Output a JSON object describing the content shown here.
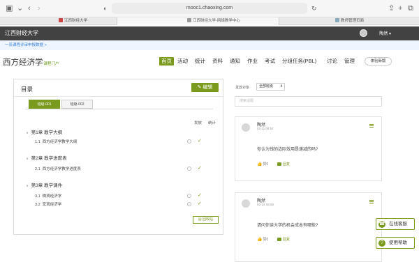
{
  "browser": {
    "url": "mooc1.chaoxing.com",
    "tabs": [
      {
        "label": "江西财经大学",
        "active": false
      },
      {
        "label": "江西财经大学-网络教学中心",
        "active": true
      },
      {
        "label": "教师管理页面",
        "active": false
      }
    ]
  },
  "topbar": {
    "school": "江西财经大学",
    "user": "陶然"
  },
  "notice": {
    "text": "一流课程评审申报数据  >"
  },
  "course": {
    "title": "西方经济学",
    "subtitle": "课程门户"
  },
  "nav": {
    "items": [
      "首页",
      "活动",
      "统计",
      "资料",
      "通知",
      "作业",
      "考试",
      "分组任务(PBL)",
      "讨论",
      "管理"
    ],
    "experience_btn": "体验新版"
  },
  "toc": {
    "title": "目录",
    "edit_label": "编辑",
    "class_tabs": [
      "班级-001",
      "班级-002"
    ],
    "col_publish": "发放",
    "col_stats": "统计",
    "chapters": [
      {
        "title": "第1章  教学大纲",
        "lessons": [
          {
            "num": "1.1",
            "title": "西方经济学教学大纲"
          }
        ]
      },
      {
        "title": "第2章  教学进度表",
        "lessons": [
          {
            "num": "2.1",
            "title": "西方经济学教学进度表"
          }
        ]
      },
      {
        "title": "第3章  教学课件",
        "lessons": [
          {
            "num": "3.1",
            "title": "微观经济学"
          },
          {
            "num": "3.2",
            "title": "宏观经济学"
          }
        ]
      }
    ],
    "recycle_label": "回收站"
  },
  "discussion": {
    "publish_label": "发放对象",
    "publish_select": "全部班级",
    "search_placeholder": "搜索话题",
    "posts": [
      {
        "author": "陶然",
        "date": "03-11 08:57",
        "text": "你认为钱的边际效用是递减的吗?",
        "like_label": "赞0",
        "reply_label": "回复"
      },
      {
        "author": "陶然",
        "date": "02-24 09:59",
        "text": "请问你读大学的机会成本有哪些?",
        "like_label": "赞0",
        "reply_label": "回复"
      }
    ]
  },
  "help": {
    "online_service": "在线客服",
    "usage_help": "使用帮助"
  },
  "colors": {
    "accent": "#7a9a1e",
    "topbar": "#424242",
    "link": "#3a7fd5"
  }
}
